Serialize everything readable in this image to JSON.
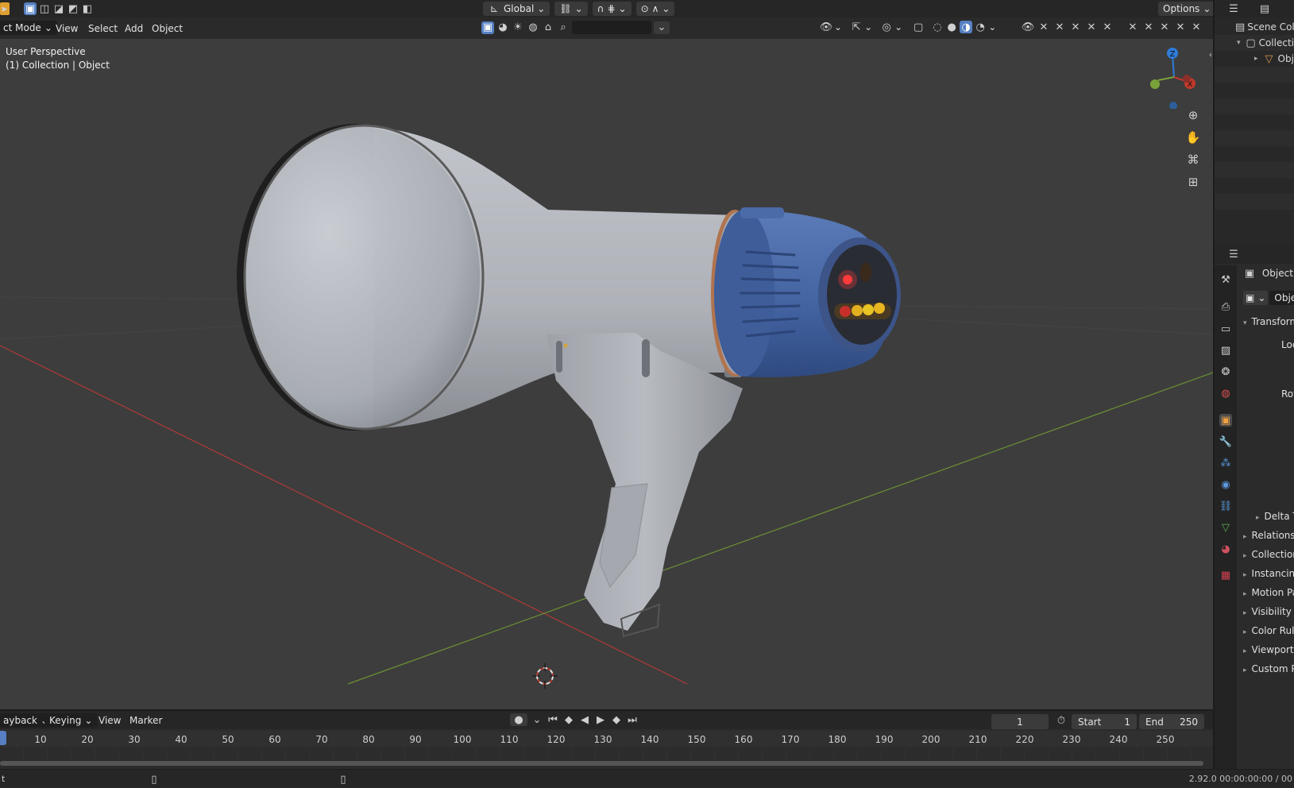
{
  "header": {
    "transform_orientation": "Global",
    "options_label": "Options"
  },
  "menubar": {
    "mode_label": "ct Mode",
    "menus": [
      "View",
      "Select",
      "Add",
      "Object"
    ]
  },
  "viewport": {
    "perspective_label": "User Perspective",
    "context_label": "(1) Collection | Object",
    "gizmo_axes": [
      "Z",
      "X",
      "Y"
    ]
  },
  "outliner": {
    "rows": [
      "Scene Colle",
      "Collecti",
      "Obj"
    ]
  },
  "properties": {
    "tab_title": "Object",
    "object_name": "Objec",
    "transform_label": "Transform",
    "location_label": "Loc",
    "rotation_label": "Rot",
    "panels": [
      "Delta T",
      "Relations",
      "Collection",
      "Instancin",
      "Motion Pa",
      "Visibility",
      "Color Rul",
      "Viewport",
      "Custom P"
    ]
  },
  "timeline": {
    "menus": [
      "ayback",
      "Keying",
      "View",
      "Marker"
    ],
    "current_frame": "1",
    "start_label": "Start",
    "start_value": "1",
    "end_label": "End",
    "end_value": "250",
    "ticks": [
      "10",
      "20",
      "30",
      "40",
      "50",
      "60",
      "70",
      "80",
      "90",
      "100",
      "110",
      "120",
      "130",
      "140",
      "150",
      "160",
      "170",
      "180",
      "190",
      "200",
      "210",
      "220",
      "230",
      "240",
      "250"
    ]
  },
  "statusbar": {
    "left_text": "t",
    "version_text": "2.92.0  00:00:00:00 / 00"
  },
  "colors": {
    "accent": "#5680c2",
    "x_axis": "#c0392b",
    "y_axis": "#7aa23a",
    "z_axis": "#2f7bd8"
  }
}
